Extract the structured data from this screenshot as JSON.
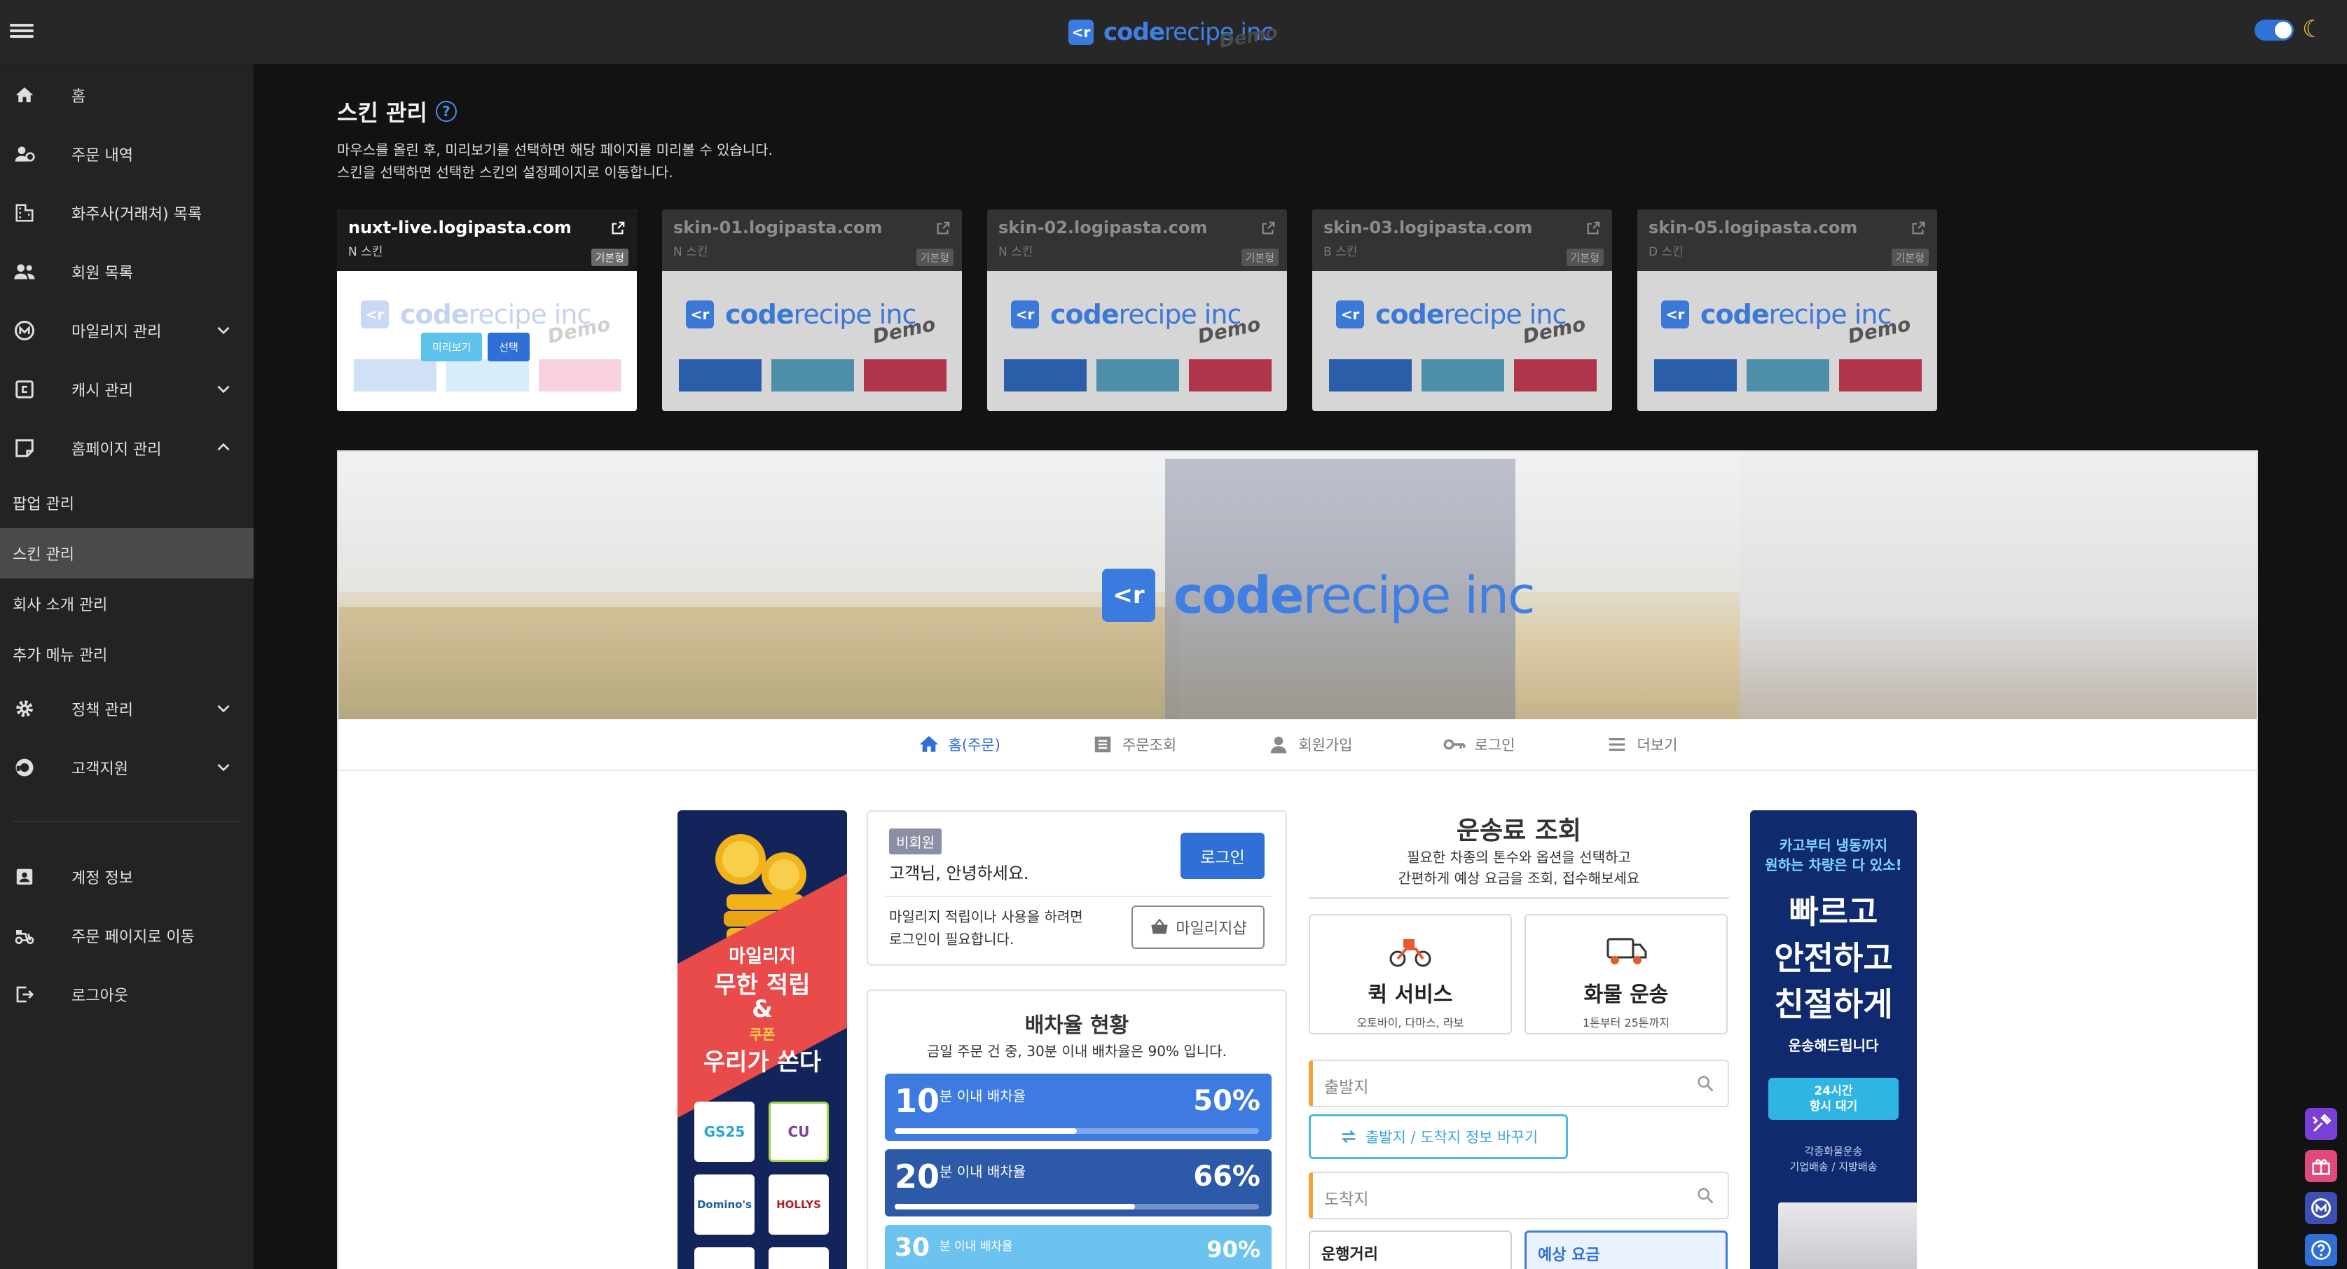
{
  "topbar": {
    "brand_icon": "<r",
    "brand_text_bold": "code",
    "brand_text_light": "recipe inc",
    "brand_demo": "Demo"
  },
  "sidebar": {
    "items": [
      {
        "label": "홈",
        "icon": "home-icon"
      },
      {
        "label": "주문 내역",
        "icon": "order-history-icon"
      },
      {
        "label": "화주사(거래처) 목록",
        "icon": "building-icon"
      },
      {
        "label": "회원 목록",
        "icon": "people-icon"
      },
      {
        "label": "마일리지 관리",
        "icon": "mileage-icon"
      },
      {
        "label": "캐시 관리",
        "icon": "cash-icon"
      },
      {
        "label": "홈페이지 관리",
        "icon": "webpage-icon"
      }
    ],
    "subitems": [
      "팝업 관리",
      "스킨 관리",
      "회사 소개 관리",
      "추가 메뉴 관리"
    ],
    "items2": [
      {
        "label": "정책 관리",
        "icon": "gear-icon"
      },
      {
        "label": "고객지원",
        "icon": "support-icon"
      }
    ],
    "bottom": [
      {
        "label": "계정 정보",
        "icon": "account-icon"
      },
      {
        "label": "주문 페이지로 이동",
        "icon": "delivery-icon"
      },
      {
        "label": "로그아웃",
        "icon": "logout-icon"
      }
    ]
  },
  "page": {
    "title": "스킨 관리",
    "help_icon": "?",
    "desc_line1": "마우스를 올린 후, 미리보기를 선택하면 해당 페이지를 미리볼 수 있습니다.",
    "desc_line2": "스킨을 선택하면 선택한 스킨의 설정페이지로 이동합니다."
  },
  "skins": [
    {
      "domain": "nuxt-live.logipasta.com",
      "skin": "N 스킨",
      "badge": "기본형",
      "preview_btn": "미리보기",
      "select_btn": "선택",
      "colors": [
        "#cfe0f7",
        "#d9ecfa",
        "#f8d2dc"
      ]
    },
    {
      "domain": "skin-01.logipasta.com",
      "skin": "N 스킨",
      "badge": "기본형",
      "colors": [
        "#2a5ea8",
        "#4d8fa8",
        "#b0354a"
      ]
    },
    {
      "domain": "skin-02.logipasta.com",
      "skin": "N 스킨",
      "badge": "기본형",
      "colors": [
        "#2a5ea8",
        "#4d8fa8",
        "#b0354a"
      ]
    },
    {
      "domain": "skin-03.logipasta.com",
      "skin": "B 스킨",
      "badge": "기본형",
      "colors": [
        "#2a5ea8",
        "#4d8fa8",
        "#b0354a"
      ]
    },
    {
      "domain": "skin-05.logipasta.com",
      "skin": "D 스킨",
      "badge": "기본형",
      "colors": [
        "#2a5ea8",
        "#4d8fa8",
        "#b0354a"
      ]
    }
  ],
  "skin_logo": {
    "icon": "<r",
    "bold": "code",
    "light": "recipe inc",
    "demo": "Demo"
  },
  "preview": {
    "hero_logo": {
      "icon": "<r",
      "bold": "code",
      "light": "recipe inc"
    },
    "nav": [
      {
        "label": "홈(주문)",
        "icon": "home-icon"
      },
      {
        "label": "주문조회",
        "icon": "list-icon"
      },
      {
        "label": "회원가입",
        "icon": "person-icon"
      },
      {
        "label": "로그인",
        "icon": "key-icon"
      },
      {
        "label": "더보기",
        "icon": "menu-icon"
      }
    ],
    "left_banner": {
      "line1": "마일리지",
      "line2": "무한 적립",
      "line3": "&",
      "line4": "쿠폰",
      "line5": "우리가 쏜다",
      "brands": [
        "GS25",
        "CU",
        "Domino's",
        "HOLLYS"
      ]
    },
    "welcome": {
      "badge": "비회원",
      "hello": "고객님, 안녕하세요.",
      "login": "로그인",
      "note_line1": "마일리지 적립이나 사용을 하려면",
      "note_line2": "로그인이 필요합니다.",
      "mall": "마일리지샵"
    },
    "rate": {
      "title": "배차율 현황",
      "subtitle": "금일 주문 건 중, 30분 이내 배차율은 90% 입니다.",
      "bars": [
        {
          "min": "10",
          "text": "분 이내 배차율",
          "pct": "50%",
          "value": 0.5,
          "color": "#3d7be0"
        },
        {
          "min": "20",
          "text": "분 이내 배차율",
          "pct": "66%",
          "value": 0.66,
          "color": "#2c5aa8"
        },
        {
          "min": "30",
          "text": "분 이내 배차율",
          "pct": "90%",
          "value": 0.9,
          "color": "#6cc3ef"
        }
      ]
    },
    "fare": {
      "title": "운송료 조회",
      "desc_line1": "필요한 차종의 톤수와 옵션을 선택하고",
      "desc_line2": "간편하게 예상 요금을 조회, 접수해보세요",
      "services": [
        {
          "name": "퀵 서비스",
          "desc": "오토바이, 다마스, 라보",
          "icon": "motorcycle-icon"
        },
        {
          "name": "화물 운송",
          "desc": "1톤부터 25톤까지",
          "icon": "truck-icon"
        }
      ],
      "origin_placeholder": "출발지",
      "swap": "출발지 / 도착지 정보 바꾸기",
      "dest_placeholder": "도착지",
      "distance": "운행거리",
      "estimate": "예상 요금"
    },
    "right_banner": {
      "line1a": "카고부터 냉동까지",
      "line1b": "원하는 차량은 다 있소!",
      "big1": "빠르고",
      "big2": "안전하고",
      "big3": "친절하게",
      "small": "운송해드립니다",
      "pill1": "24시간",
      "pill2": "항시 대기",
      "foot1": "각종화물운송",
      "foot2": "기업배송 / 지방배송"
    }
  },
  "fabs": [
    {
      "icon": "tools-icon",
      "color": "#7a3fd6"
    },
    {
      "icon": "gift-icon",
      "color": "#e04a7a"
    },
    {
      "icon": "mileage-icon",
      "color": "#3d4fb5"
    },
    {
      "icon": "help-icon",
      "color": "#2f6fd6"
    }
  ]
}
